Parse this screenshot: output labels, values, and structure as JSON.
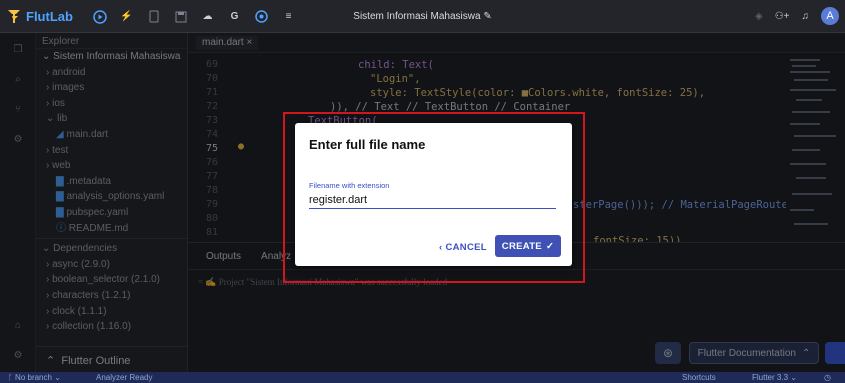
{
  "app": {
    "name": "FlutLab",
    "project_title": "Sistem Informasi Mahasiswa",
    "avatar_letter": "A"
  },
  "explorer": {
    "header": "Explorer",
    "root": "Sistem Informasi Mahasiswa",
    "items": [
      "android",
      "images",
      "ios",
      "lib",
      "main.dart",
      "test",
      "web",
      ".metadata",
      "analysis_options.yaml",
      "pubspec.yaml",
      "README.md"
    ],
    "dependencies_label": "Dependencies",
    "dependencies": [
      "async (2.9.0)",
      "boolean_selector (2.1.0)",
      "characters (1.2.1)",
      "clock (1.1.1)",
      "collection (1.16.0)"
    ],
    "outline_label": "Flutter Outline"
  },
  "editor": {
    "tab_label": "main.dart ×",
    "line_numbers": [
      "69",
      "70",
      "71",
      "72",
      "73",
      "74",
      "75",
      "76",
      "77",
      "78",
      "79",
      "80",
      "81"
    ],
    "code": {
      "l69": "child: Text(",
      "l70": "\"Login\",",
      "l71": "style: TextStyle(color: ■Colors.white, fontSize: 25),",
      "l72": ")), // Text // TextButton // Container",
      "l73": "TextButton(",
      "l79": "sterPage())); // MaterialPageRoute",
      "l81": "fontSize: 15)),"
    }
  },
  "panel": {
    "tabs": [
      "Outputs",
      "Analyz"
    ],
    "message": "= ✍ Project \"Sistem Informasi Mahasiswa\" was successfully loaded"
  },
  "dialog": {
    "title": "Enter full file name",
    "field_label": "Filename with extension",
    "field_value": "register.dart",
    "cancel_label": "CANCEL",
    "create_label": "CREATE"
  },
  "bottom_buttons": {
    "docs_label": "Flutter Documentation"
  },
  "statusbar": {
    "branch": "No branch",
    "analyzer": "Analyzer Ready",
    "shortcuts": "Shortcuts",
    "flutter_version": "Flutter 3.3"
  }
}
